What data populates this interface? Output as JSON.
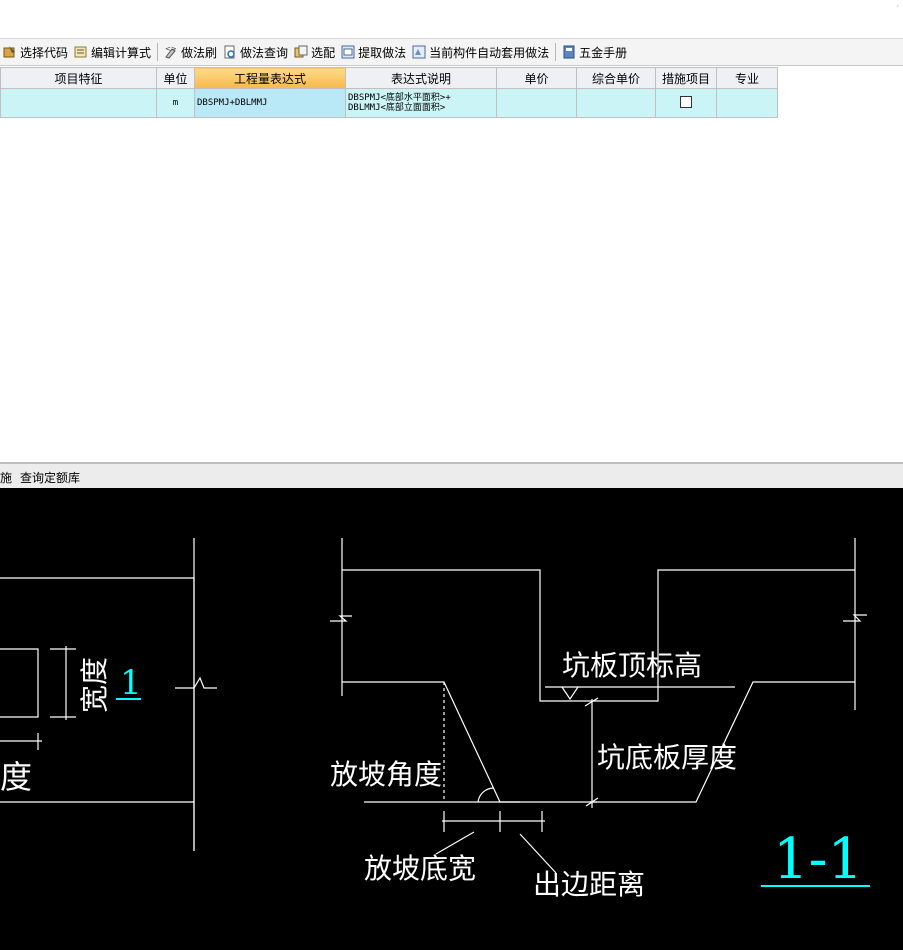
{
  "toolbar": {
    "items": [
      {
        "label": "选择代码",
        "icon": "code-select-icon"
      },
      {
        "label": "编辑计算式",
        "icon": "edit-formula-icon"
      },
      {
        "label": "做法刷",
        "icon": "method-brush-icon"
      },
      {
        "label": "做法查询",
        "icon": "method-query-icon"
      },
      {
        "label": "选配",
        "icon": "select-match-icon"
      },
      {
        "label": "提取做法",
        "icon": "extract-method-icon"
      },
      {
        "label": "当前构件自动套用做法",
        "icon": "auto-apply-icon"
      },
      {
        "label": "五金手册",
        "icon": "hardware-manual-icon"
      }
    ]
  },
  "table": {
    "headers": [
      "项目特征",
      "单位",
      "工程量表达式",
      "表达式说明",
      "单价",
      "综合单价",
      "措施项目",
      "专业"
    ],
    "row": {
      "unit": "m",
      "expression": "DBSPMJ+DBLMMJ",
      "desc_line1": "DBSPMJ<底部水平面积>+",
      "desc_line2": "DBLMMJ<底部立面面积>",
      "measure_checked": false
    }
  },
  "lower_bar": {
    "tab1": "施",
    "tab2": "查询定额库"
  },
  "drawing": {
    "labels": {
      "kuandu": "宽度",
      "section_mark": "1",
      "du": "度",
      "pit_top_elev": "坑板顶标高",
      "slope_angle": "放坡角度",
      "pit_bottom_thickness": "坑底板厚度",
      "slope_bottom_width": "放坡底宽",
      "edge_distance": "出边距离",
      "section_title": "1-1"
    },
    "colors": {
      "line": "#ffffff",
      "accent": "#00ffff",
      "background": "#000000"
    }
  }
}
